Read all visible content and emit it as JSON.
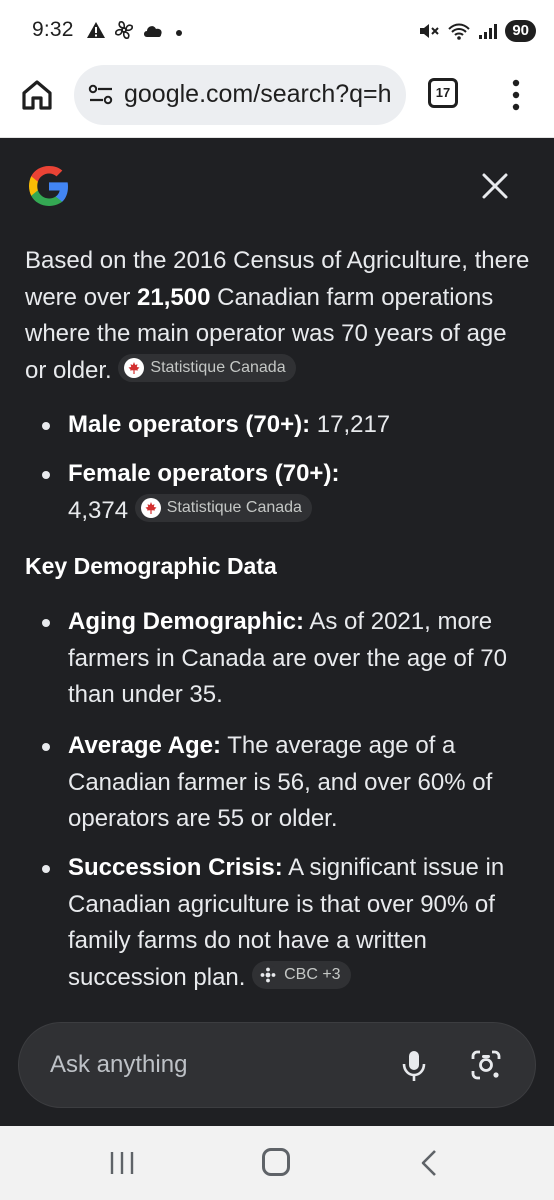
{
  "status_bar": {
    "time": "9:32",
    "battery": "90",
    "left_icons": [
      "alert-icon",
      "fan-icon",
      "cloud-icon",
      "dot-icon"
    ],
    "right_icons": [
      "mute-icon",
      "wifi-icon",
      "signal-icon",
      "battery-icon"
    ]
  },
  "browser": {
    "url": "google.com/search?q=h",
    "tab_count": "17"
  },
  "overview": {
    "para_1": "Based on the 2016 Census of Agriculture, there were over ",
    "para_bold": "21,500",
    "para_2": " Canadian farm operations where the main operator was 70 years of age or older.",
    "source_1": "Statistique Canada",
    "male_label": "Male operators (70+):",
    "male_value": " 17,217",
    "female_label": "Female operators (70+):",
    "female_value": "4,374",
    "source_2": "Statistique Canada",
    "heading": "Key Demographic Data",
    "items": [
      {
        "label": "Aging Demographic:",
        "text": " As of 2021, more farmers in Canada are over the age of 70 than under 35."
      },
      {
        "label": "Average Age:",
        "text": " The average age of a Canadian farmer is 56, and over 60% of operators are 55 or older."
      },
      {
        "label": "Succession Crisis:",
        "text": " A significant issue in Canadian agriculture is that over 90% of family farms do not have a written succession plan."
      }
    ],
    "source_3": "CBC +3"
  },
  "ask": {
    "placeholder": "Ask anything"
  },
  "colors": {
    "background": "#1f2023",
    "chip": "#303134",
    "maple": "#d32f2f"
  }
}
